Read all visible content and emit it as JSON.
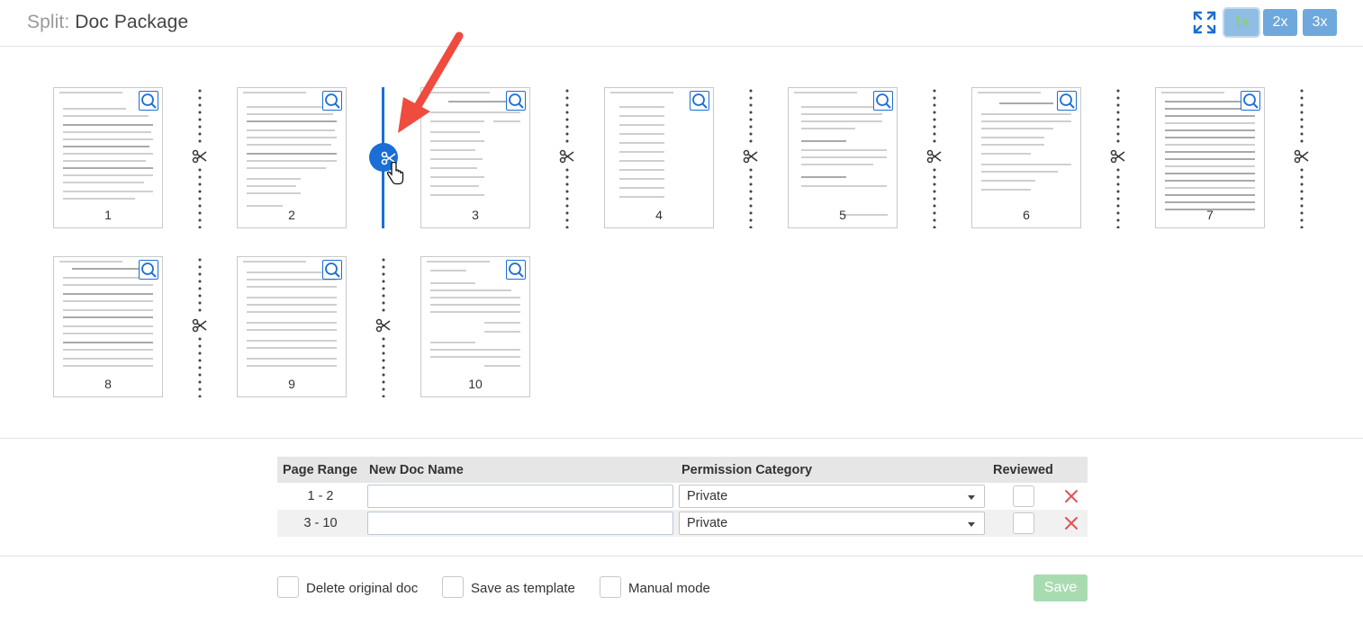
{
  "header": {
    "title_prefix": "Split:",
    "title": "Doc Package",
    "zoom_options": [
      "1x",
      "2x",
      "3x"
    ],
    "active_zoom": "1x",
    "icons": {
      "expand": "expand-icon",
      "page_zoom": "magnifier-icon",
      "split": "scissors-icon",
      "delete": "close-x-icon"
    }
  },
  "pages": [
    "1",
    "2",
    "3",
    "4",
    "5",
    "6",
    "7",
    "8",
    "9",
    "10"
  ],
  "split_after_page": "2",
  "table": {
    "headers": {
      "range": "Page Range",
      "name": "New Doc Name",
      "permission": "Permission Category",
      "reviewed": "Reviewed"
    },
    "rows": [
      {
        "range": "1 - 2",
        "name": "",
        "permission": "Private",
        "reviewed": false
      },
      {
        "range": "3 - 10",
        "name": "",
        "permission": "Private",
        "reviewed": false
      }
    ]
  },
  "footer": {
    "delete_original": "Delete original doc",
    "save_template": "Save as template",
    "manual_mode": "Manual mode",
    "save": "Save"
  },
  "colors": {
    "accent": "#1b6ed6",
    "zoom_button": "#6fa8dc",
    "save_button_disabled": "#a8dcb0",
    "delete_icon": "#e05555"
  }
}
